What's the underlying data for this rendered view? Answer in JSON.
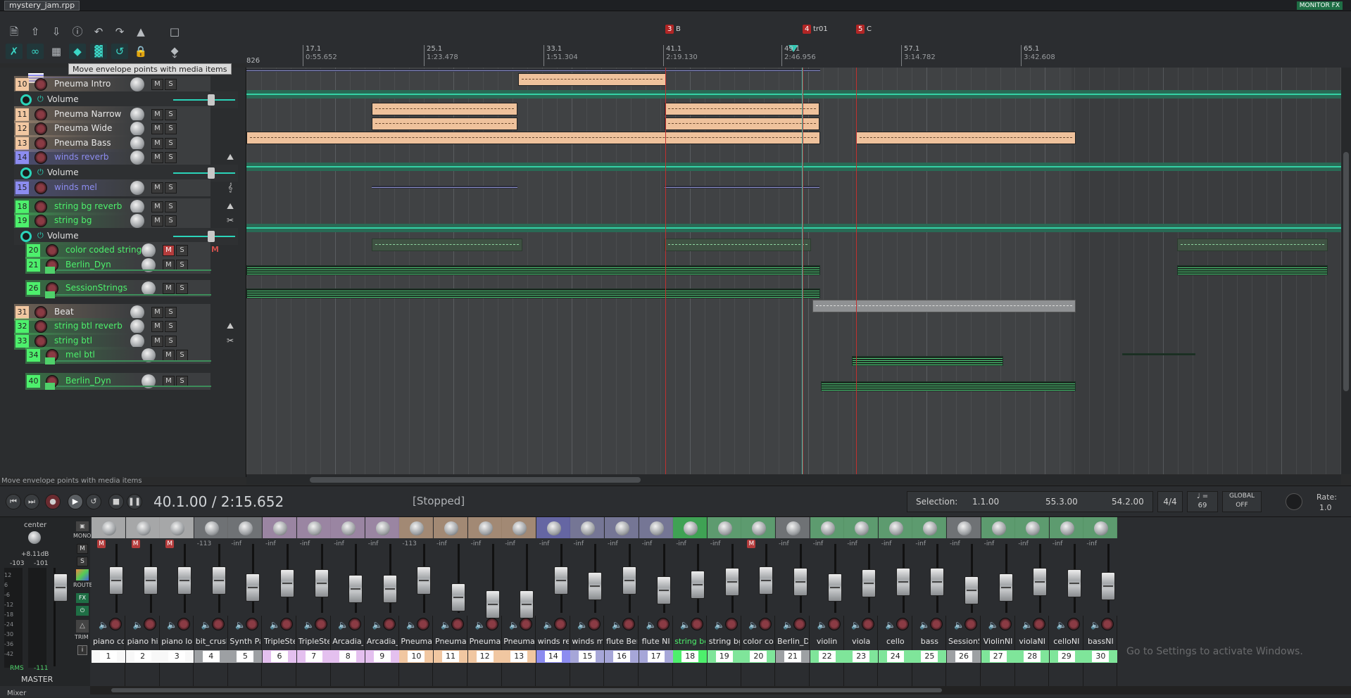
{
  "window": {
    "title": "mystery_jam.rpp",
    "monitor_fx": "MONITOR FX"
  },
  "tooltip": "Move envelope points with media items",
  "status_hint": "Move envelope points with media items",
  "markers": [
    {
      "id": "3",
      "name": "B"
    },
    {
      "id": "4",
      "name": "tr01"
    },
    {
      "id": "5",
      "name": "C"
    }
  ],
  "ruler": {
    "first": "826",
    "ticks": [
      {
        "bar": "17.1",
        "time": "0:55.652"
      },
      {
        "bar": "25.1",
        "time": "1:23.478"
      },
      {
        "bar": "33.1",
        "time": "1:51.304"
      },
      {
        "bar": "41.1",
        "time": "2:19.130"
      },
      {
        "bar": "49.1",
        "time": "2:46.956"
      },
      {
        "bar": "57.1",
        "time": "3:14.782"
      },
      {
        "bar": "65.1",
        "time": "3:42.608"
      }
    ]
  },
  "tracks": [
    {
      "num": "10",
      "name": "Pneuma Intro",
      "color": "#f1c7a1",
      "mute": false
    },
    {
      "num": "11",
      "name": "Pneuma Narrow",
      "color": "#f1c7a1",
      "mute": false
    },
    {
      "num": "12",
      "name": "Pneuma Wide",
      "color": "#f1c7a1",
      "mute": false
    },
    {
      "num": "13",
      "name": "Pneuma Bass",
      "color": "#f1c7a1",
      "mute": false
    },
    {
      "num": "14",
      "name": "winds reverb",
      "color": "#8c8cf0",
      "mute": false
    },
    {
      "num": "15",
      "name": "winds mel",
      "color": "#8c8cf0",
      "mute": false
    },
    {
      "num": "18",
      "name": "string bg reverb",
      "color": "#4df06c",
      "mute": false
    },
    {
      "num": "19",
      "name": "string bg",
      "color": "#4df06c",
      "mute": false
    },
    {
      "num": "20",
      "name": "color coded string",
      "color": "#4df06c",
      "mute": true
    },
    {
      "num": "21",
      "name": "Berlin_Dyn",
      "color": "#4df06c",
      "mute": false
    },
    {
      "num": "26",
      "name": "SessionStrings",
      "color": "#4df06c",
      "mute": false
    },
    {
      "num": "31",
      "name": "Beat",
      "color": "#f1c7a1",
      "mute": false
    },
    {
      "num": "32",
      "name": "string btl reverb",
      "color": "#4df06c",
      "mute": false
    },
    {
      "num": "33",
      "name": "string btl",
      "color": "#4df06c",
      "mute": false
    },
    {
      "num": "34",
      "name": "mel btl",
      "color": "#4df06c",
      "mute": false
    },
    {
      "num": "40",
      "name": "Berlin_Dyn",
      "color": "#4df06c",
      "mute": false
    }
  ],
  "envelope_label": "Volume",
  "ms": {
    "m": "M",
    "s": "S"
  },
  "transport": {
    "position": "40.1.00 / 2:15.652",
    "state": "[Stopped]",
    "selection_label": "Selection:",
    "selection_start": "1.1.00",
    "selection_end": "55.3.00",
    "selection_length": "54.2.00",
    "time_sig": "4/4",
    "bpm": "69",
    "bpm_note": "♩ =",
    "global": "GLOBAL",
    "global_state": "OFF",
    "rate_label": "Rate:",
    "rate": "1.0"
  },
  "master": {
    "pan_label": "center",
    "peak": "+8.11dB",
    "lvl_l": "-103",
    "lvl_r": "-101",
    "rms": "RMS",
    "rms_val": "-111",
    "label": "MASTER",
    "mono": "MONO",
    "route": "ROUTE",
    "fx": "FX",
    "trim": "TRIM",
    "scale": [
      "12",
      "6",
      "-6",
      "-12",
      "-18",
      "-24",
      "-30",
      "-36",
      "-42"
    ]
  },
  "mixer_tab": "Mixer",
  "mixer": [
    {
      "name": "piano cor",
      "num": "1",
      "color": "#f8f8f8",
      "db": "",
      "rec": true
    },
    {
      "name": "piano hi",
      "num": "2",
      "color": "#f8f8f8",
      "db": "",
      "rec": true
    },
    {
      "name": "piano lo",
      "num": "3",
      "color": "#f8f8f8",
      "db": "",
      "rec": true
    },
    {
      "name": "bit_crush",
      "num": "4",
      "color": "#9da0a3",
      "db": "-113",
      "rec": false
    },
    {
      "name": "Synth Pad",
      "num": "5",
      "color": "#9da0a3",
      "db": "-inf",
      "rec": false
    },
    {
      "name": "TripleStep",
      "num": "6",
      "color": "#e4c0ef",
      "db": "-inf",
      "rec": false
    },
    {
      "name": "TripleStep",
      "num": "7",
      "color": "#e4c0ef",
      "db": "-inf",
      "rec": false
    },
    {
      "name": "Arcadia_l",
      "num": "8",
      "color": "#e4c0ef",
      "db": "-inf",
      "rec": false
    },
    {
      "name": "Arcadia_l",
      "num": "9",
      "color": "#e4c0ef",
      "db": "-inf",
      "rec": false
    },
    {
      "name": "Pneuma I",
      "num": "10",
      "color": "#f1c7a1",
      "db": "-113",
      "rec": false
    },
    {
      "name": "Pneuma N",
      "num": "11",
      "color": "#f1c7a1",
      "db": "-inf",
      "rec": false
    },
    {
      "name": "Pneuma W",
      "num": "12",
      "color": "#f1c7a1",
      "db": "-inf",
      "rec": false
    },
    {
      "name": "Pneuma E",
      "num": "13",
      "color": "#f1c7a1",
      "db": "-inf",
      "rec": false
    },
    {
      "name": "winds rev",
      "num": "14",
      "color": "#8c8cf0",
      "db": "-inf",
      "rec": false
    },
    {
      "name": "winds me",
      "num": "15",
      "color": "#a6a6d8",
      "db": "-inf",
      "rec": false
    },
    {
      "name": "flute Berli",
      "num": "16",
      "color": "#a6a6d8",
      "db": "-inf",
      "rec": false
    },
    {
      "name": "flute NI",
      "num": "17",
      "color": "#a6a6d8",
      "db": "-inf",
      "rec": false
    },
    {
      "name": "string bg",
      "num": "18",
      "color": "#4df06c",
      "db": "-inf",
      "rec": false
    },
    {
      "name": "string bg",
      "num": "19",
      "color": "#7fe59a",
      "db": "-inf",
      "rec": false
    },
    {
      "name": "color cod",
      "num": "20",
      "color": "#7fe59a",
      "db": "",
      "rec": true
    },
    {
      "name": "Berlin_Dy",
      "num": "21",
      "color": "#9da0a3",
      "db": "-inf",
      "rec": false
    },
    {
      "name": "violin",
      "num": "22",
      "color": "#7fe59a",
      "db": "-inf",
      "rec": false
    },
    {
      "name": "viola",
      "num": "23",
      "color": "#7fe59a",
      "db": "-inf",
      "rec": false
    },
    {
      "name": "cello",
      "num": "24",
      "color": "#7fe59a",
      "db": "-inf",
      "rec": false
    },
    {
      "name": "bass",
      "num": "25",
      "color": "#7fe59a",
      "db": "-inf",
      "rec": false
    },
    {
      "name": "SessionSt",
      "num": "26",
      "color": "#9da0a3",
      "db": "-inf",
      "rec": false
    },
    {
      "name": "ViolinNI",
      "num": "27",
      "color": "#7fe59a",
      "db": "-inf",
      "rec": false
    },
    {
      "name": "violaNI",
      "num": "28",
      "color": "#7fe59a",
      "db": "-inf",
      "rec": false
    },
    {
      "name": "celloNI",
      "num": "29",
      "color": "#7fe59a",
      "db": "-inf",
      "rec": false
    },
    {
      "name": "bassNI",
      "num": "30",
      "color": "#7fe59a",
      "db": "-inf",
      "rec": false
    }
  ],
  "watermark": "Go to Settings to activate Windows."
}
